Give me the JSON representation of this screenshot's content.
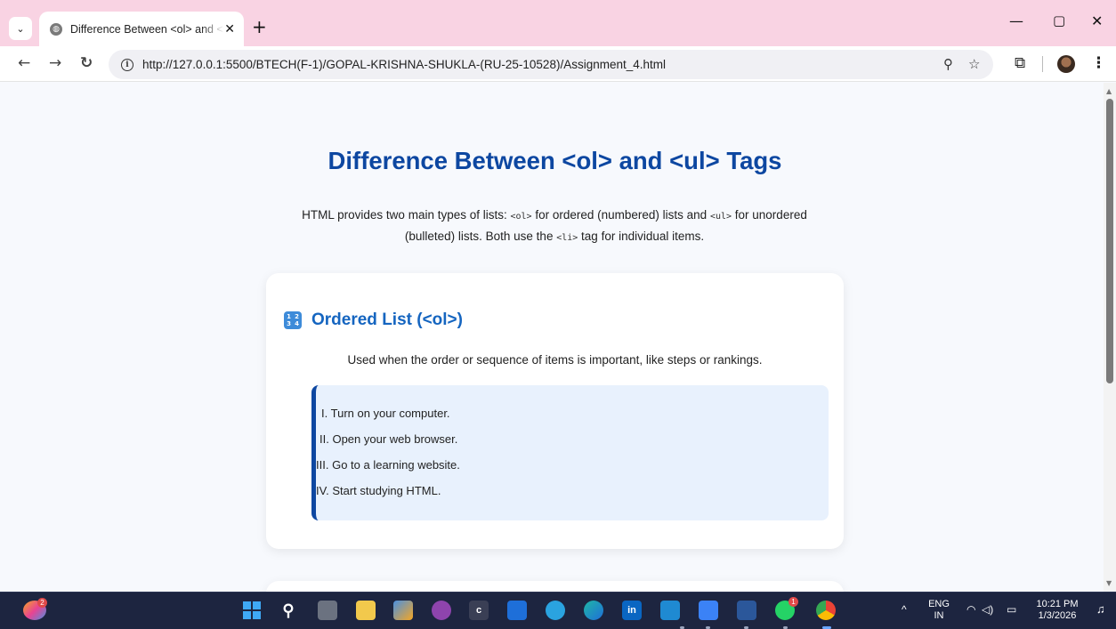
{
  "browser": {
    "tab_title": "Difference Between <ol> and <ul> Tags",
    "new_tab_symbol": "+",
    "close_symbol": "✕",
    "url_prefix": "http://",
    "url_host": "127.0.0.1",
    "url_path": ":5500/BTECH(F-1)/GOPAL-KRISHNA-SHUKLA-(RU-25-10528)/Assignment_4.html",
    "icons": [
      "tab-menu-icon",
      "globe-icon",
      "back-icon",
      "forward-icon",
      "reload-icon",
      "site-info-icon",
      "zoom-icon",
      "bookmark-star-icon",
      "extensions-icon",
      "profile-avatar",
      "more-menu-icon",
      "minimize-icon",
      "restore-icon",
      "close-window-icon"
    ]
  },
  "page": {
    "title": "Difference Between <ol> and <ul> Tags",
    "intro_part1": "HTML provides two main types of lists: ",
    "intro_code1": "<ol>",
    "intro_part2": " for ordered (numbered) lists and ",
    "intro_code2": "<ul>",
    "intro_part3": " for unordered (bulleted) lists. Both use the ",
    "intro_code3": "<li>",
    "intro_part4": " tag for individual items."
  },
  "ordered_card": {
    "icon_digits": [
      "1",
      "2",
      "3",
      "4"
    ],
    "heading": "Ordered List (<ol>)",
    "description": "Used when the order or sequence of items is important, like steps or rankings.",
    "items": [
      {
        "marker": "I.",
        "text": "Turn on your computer."
      },
      {
        "marker": "II.",
        "text": "Open your web browser."
      },
      {
        "marker": "III.",
        "text": "Go to a learning website."
      },
      {
        "marker": "IV.",
        "text": "Start studying HTML."
      }
    ]
  },
  "taskbar": {
    "copilot_badge": "2",
    "whatsapp_badge": "1",
    "lang_top": "ENG",
    "lang_bottom": "IN",
    "time": "10:21 PM",
    "date": "1/3/2026",
    "app_c_label": "c",
    "linkedin_label": "in",
    "colors": {
      "accent": "#0d47a1",
      "heading": "#1565c0",
      "list_bg": "#e8f1fd",
      "tabbar": "#f9d3e3",
      "taskbar": "#1d2540"
    }
  }
}
